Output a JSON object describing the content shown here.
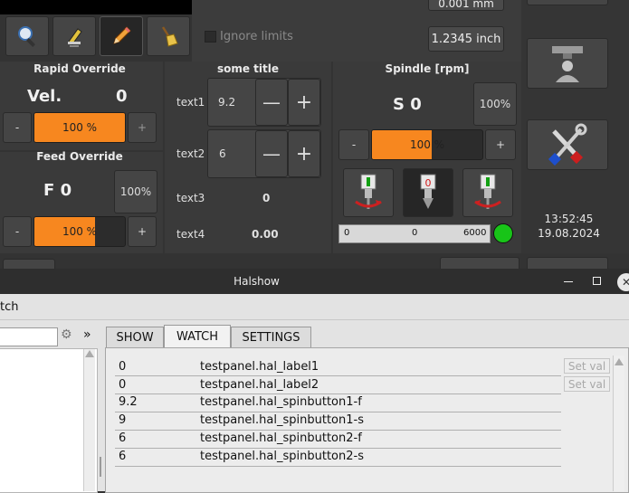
{
  "top": {
    "ignore_limits_label": "Ignore limits",
    "jog_value_partial": "0.001 mm",
    "jog_value": "1.2345 inch"
  },
  "rapid": {
    "title": "Rapid Override",
    "vel_label": "Vel.",
    "vel_value": "0",
    "minus": "-",
    "plus": "+",
    "bar_text": "100 %",
    "bar_level": 1.0
  },
  "feed": {
    "title": "Feed Override",
    "f_label": "F 0",
    "pct_button": "100%",
    "minus": "-",
    "plus": "+",
    "bar_text": "100 %",
    "bar_level": 0.67
  },
  "middle": {
    "title": "some title",
    "text1_label": "text1",
    "text1_value": "9.2",
    "text2_label": "text2",
    "text2_value": "6",
    "text3_label": "text3",
    "text3_value": "0",
    "text4_label": "text4",
    "text4_value": "0.00",
    "minus": "—",
    "plus": "+"
  },
  "spindle": {
    "title": "Spindle [rpm]",
    "s_label": "S 0",
    "pct_button": "100%",
    "minus": "-",
    "plus": "+",
    "bar_text": "100 %",
    "bar_level": 0.54,
    "gauge_left": "0",
    "gauge_mid": "0",
    "gauge_right": "6000",
    "led_color": "#18c418"
  },
  "clock": {
    "time": "13:52:45",
    "date": "19.08.2024"
  },
  "halshow": {
    "window_title": "Halshow",
    "menu_partial": "tch",
    "expand_symbol": "»",
    "tabs": [
      "SHOW",
      "WATCH",
      "SETTINGS"
    ],
    "active_tab": "WATCH",
    "rows": [
      {
        "value": "0",
        "name": "testpanel.hal_label1",
        "button": "Set val"
      },
      {
        "value": "0",
        "name": "testpanel.hal_label2",
        "button": "Set val"
      },
      {
        "value": "9.2",
        "name": "testpanel.hal_spinbutton1-f",
        "button": ""
      },
      {
        "value": "9",
        "name": "testpanel.hal_spinbutton1-s",
        "button": ""
      },
      {
        "value": "6",
        "name": "testpanel.hal_spinbutton2-f",
        "button": ""
      },
      {
        "value": "6",
        "name": "testpanel.hal_spinbutton2-s",
        "button": ""
      }
    ]
  },
  "icons": [
    "magnifier-icon",
    "wrench-touchoff-icon",
    "pencil-icon",
    "broom-icon",
    "machine-user-icon",
    "tools-icon",
    "spindle-forward-icon",
    "spindle-stop-icon",
    "spindle-reverse-icon",
    "gear-icon"
  ]
}
